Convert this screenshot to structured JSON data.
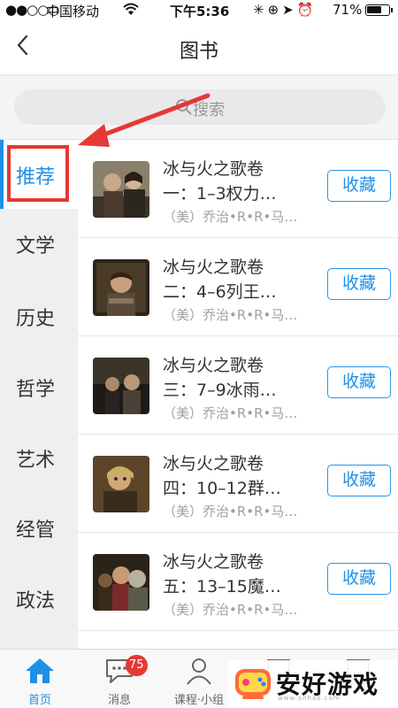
{
  "status_bar": {
    "signal": "●●○○○",
    "carrier": "中国移动",
    "time": "下午5:36",
    "battery": "71%",
    "battery_level": 0.71
  },
  "nav": {
    "back_icon": "chevron-left-icon",
    "title": "图书"
  },
  "search": {
    "placeholder": "搜索",
    "icon": "search-icon"
  },
  "sidebar": {
    "active_color": "#1e90e8",
    "items": [
      {
        "label": "推荐",
        "active": true
      },
      {
        "label": "文学"
      },
      {
        "label": "历史"
      },
      {
        "label": "哲学"
      },
      {
        "label": "艺术"
      },
      {
        "label": "经管"
      },
      {
        "label": "政法"
      }
    ]
  },
  "books": [
    {
      "title_line1": "冰与火之歌卷",
      "title_line2": "一：1–3权力…",
      "author": "（美）乔治•R•R•马…",
      "action": "收藏"
    },
    {
      "title_line1": "冰与火之歌卷",
      "title_line2": "二：4–6列王…",
      "author": "（美）乔治•R•R•马…",
      "action": "收藏"
    },
    {
      "title_line1": "冰与火之歌卷",
      "title_line2": "三：7–9冰雨…",
      "author": "（美）乔治•R•R•马…",
      "action": "收藏"
    },
    {
      "title_line1": "冰与火之歌卷",
      "title_line2": "四：10–12群…",
      "author": "（美）乔治•R•R•马…",
      "action": "收藏"
    },
    {
      "title_line1": "冰与火之歌卷",
      "title_line2": "五：13–15魔…",
      "author": "（美）乔治•R•R•马…",
      "action": "收藏"
    }
  ],
  "tab_bar": {
    "tabs": [
      {
        "label": "首页",
        "icon": "home-icon",
        "active": true
      },
      {
        "label": "消息",
        "icon": "message-icon",
        "badge": "75"
      },
      {
        "label": "课程·小组",
        "icon": "person-icon"
      },
      {
        "label": "",
        "icon": "edit-icon"
      },
      {
        "label": "",
        "icon": "more-icon"
      }
    ]
  },
  "watermark": {
    "brand": "安好游戏",
    "sub": "www.anhao.com"
  }
}
